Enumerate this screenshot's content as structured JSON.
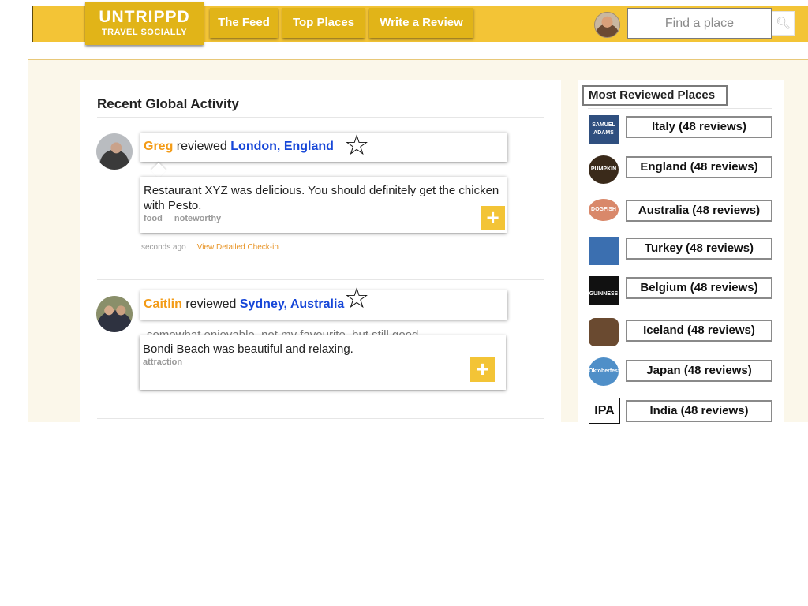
{
  "brand": {
    "name": "UNTRIPPD",
    "tagline": "TRAVEL SOCIALLY"
  },
  "nav": [
    {
      "label": "The Feed"
    },
    {
      "label": "Top Places"
    },
    {
      "label": "Write a Review"
    }
  ],
  "search": {
    "placeholder": "Find a place",
    "icon": "search-icon"
  },
  "activity": {
    "title": "Recent Global Activity",
    "items": [
      {
        "user": "Greg",
        "verb": "reviewed",
        "place": "London, England",
        "text": "Restaurant XYZ was delicious. You should definitely get the chicken with Pesto.",
        "tags": [
          "food",
          "noteworthy"
        ],
        "time": "seconds ago",
        "link": "View Detailed Check-in"
      },
      {
        "user": "Caitlin",
        "verb": "reviewed",
        "place": "Sydney, Australia",
        "text": "Bondi Beach was beautiful and relaxing.",
        "tags": [
          "attraction"
        ],
        "ghost_text": "somewhat enjoyable, not my favourite, but still good"
      }
    ]
  },
  "sidebar": {
    "title": "Most Reviewed Places",
    "places": [
      {
        "label": "Italy (48 reviews)",
        "thumb": "SAMUEL ADAMS",
        "color": "#2f4f7f"
      },
      {
        "label": "England (48 reviews)",
        "thumb": "PUMPKIN",
        "color": "#3a2a1a"
      },
      {
        "label": "Australia (48 reviews)",
        "thumb": "DOGFISH",
        "color": "#d9886a"
      },
      {
        "label": "Turkey (48 reviews)",
        "thumb": "",
        "color": "#3b6fb0"
      },
      {
        "label": "Belgium (48 reviews)",
        "thumb": "GUINNESS",
        "color": "#111111"
      },
      {
        "label": "Iceland (48 reviews)",
        "thumb": "",
        "color": "#6a4a30"
      },
      {
        "label": "Japan (48 reviews)",
        "thumb": "Oktoberfest",
        "color": "#4f8fc8"
      },
      {
        "label": "India (48 reviews)",
        "thumb": "IPA",
        "color": "#111111"
      }
    ]
  },
  "colors": {
    "brand_yellow": "#f3c436",
    "brand_dark_yellow": "#e1b418",
    "user_orange": "#f39b16",
    "place_blue": "#1747d8"
  }
}
